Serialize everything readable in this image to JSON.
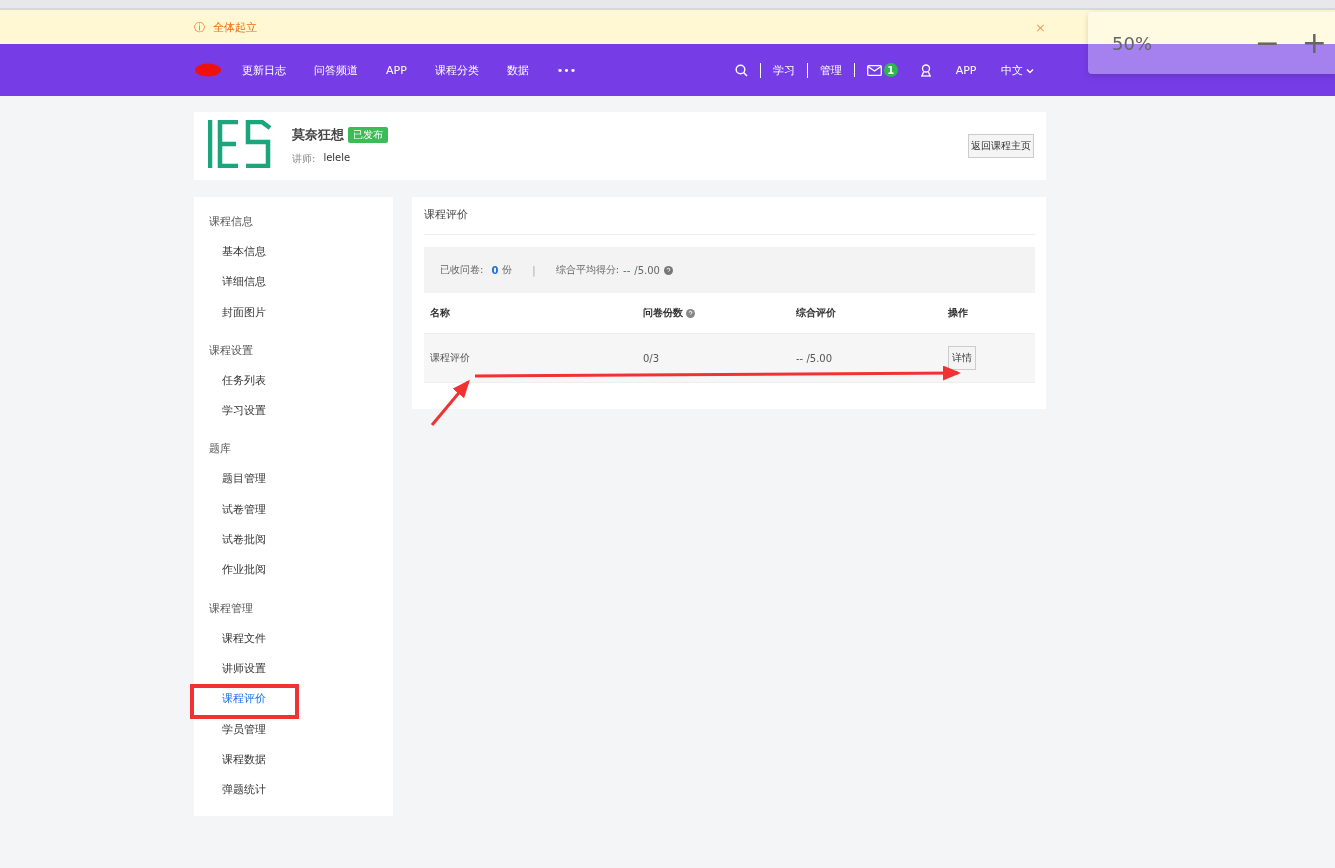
{
  "notice": {
    "icon": "ⓘ",
    "text": "全体起立",
    "close": "×"
  },
  "nav": {
    "links": [
      "更新日志",
      "问答频道",
      "APP",
      "课程分类",
      "数据",
      "•••"
    ],
    "right": [
      {
        "kind": "search"
      },
      {
        "kind": "text",
        "label": "学习"
      },
      {
        "kind": "text",
        "label": "管理"
      },
      {
        "kind": "mail",
        "badge": "1"
      },
      {
        "kind": "user"
      },
      {
        "kind": "text",
        "label": "APP"
      },
      {
        "kind": "lang",
        "label": "中文"
      }
    ]
  },
  "zoom_popup": {
    "value": "50%",
    "minus": "−",
    "plus": "+"
  },
  "course": {
    "title": "莫奈狂想",
    "status": "已发布",
    "teacher_label": "讲师:",
    "teacher": "lelele",
    "back_button": "返回课程主页"
  },
  "sidebar": {
    "groups": [
      {
        "title": "课程信息",
        "items": [
          {
            "label": "基本信息",
            "selected": false
          },
          {
            "label": "详细信息",
            "selected": false
          },
          {
            "label": "封面图片",
            "selected": false
          }
        ]
      },
      {
        "title": "课程设置",
        "items": [
          {
            "label": "任务列表",
            "selected": false
          },
          {
            "label": "学习设置",
            "selected": false
          }
        ]
      },
      {
        "title": "题库",
        "items": [
          {
            "label": "题目管理",
            "selected": false
          },
          {
            "label": "试卷管理",
            "selected": false
          },
          {
            "label": "试卷批阅",
            "selected": false
          },
          {
            "label": "作业批阅",
            "selected": false
          }
        ]
      },
      {
        "title": "课程管理",
        "items": [
          {
            "label": "课程文件",
            "selected": false
          },
          {
            "label": "讲师设置",
            "selected": false
          },
          {
            "label": "课程评价",
            "selected": true
          },
          {
            "label": "学员管理",
            "selected": false
          },
          {
            "label": "课程数据",
            "selected": false
          },
          {
            "label": "弹题统计",
            "selected": false
          }
        ]
      }
    ]
  },
  "panel": {
    "title": "课程评价",
    "summary": {
      "received_label": "已收问卷:",
      "received_count": "0",
      "received_unit": "份",
      "separator": "|",
      "avg_label": "综合平均得分:",
      "avg_value": "--",
      "avg_max": "/5.00"
    },
    "table": {
      "columns": [
        {
          "label": "名称",
          "help": false
        },
        {
          "label": "问卷份数",
          "help": true
        },
        {
          "label": "综合评价",
          "help": false
        },
        {
          "label": "操作",
          "help": false
        }
      ],
      "rows": [
        {
          "name": "课程评价",
          "count": "0/3",
          "rating": "-- /5.00",
          "action": "详情"
        }
      ]
    }
  }
}
